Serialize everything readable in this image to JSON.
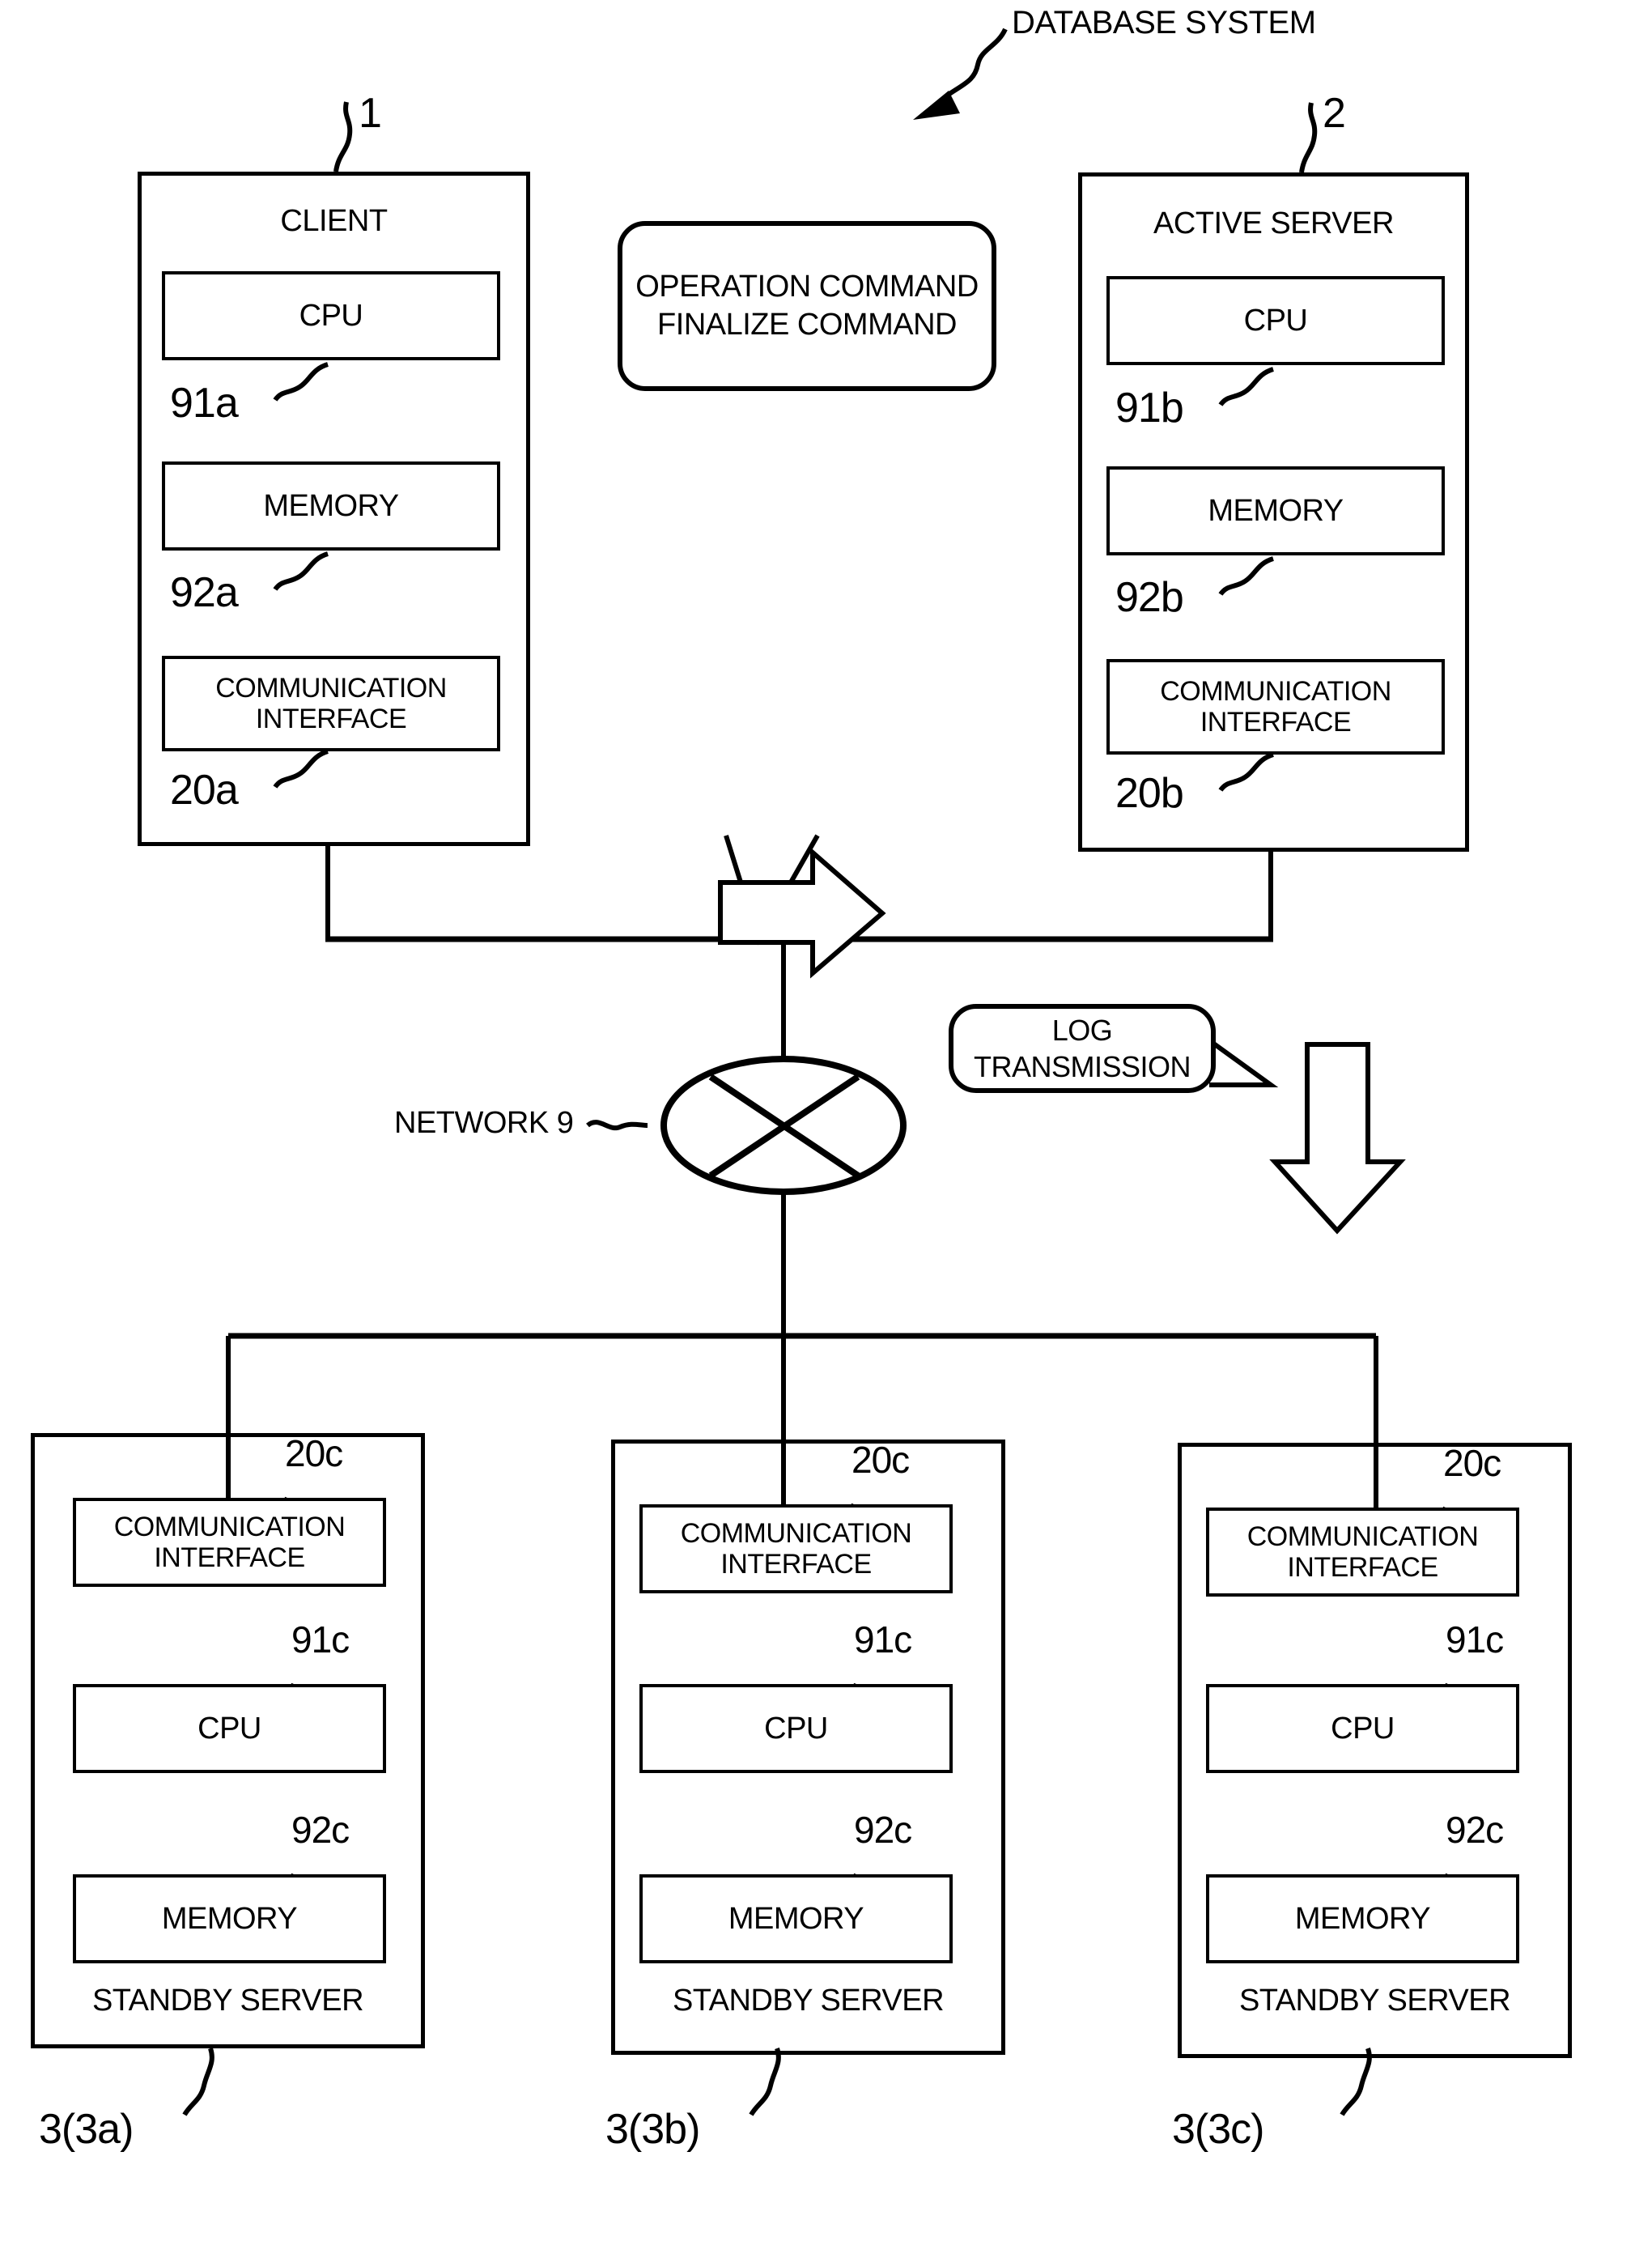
{
  "figure": {
    "title": "DATABASE SYSTEM",
    "network_label": "NETWORK 9",
    "network_ref": "9"
  },
  "callouts": {
    "command_bubble": {
      "line1": "OPERATION COMMAND",
      "line2": "FINALIZE COMMAND"
    },
    "log_bubble": {
      "line1": "LOG",
      "line2": "TRANSMISSION"
    }
  },
  "client": {
    "title": "CLIENT",
    "ref": "1",
    "units": [
      {
        "label": "CPU",
        "ref": "91a"
      },
      {
        "label": "MEMORY",
        "ref": "92a"
      },
      {
        "label_line1": "COMMUNICATION",
        "label_line2": "INTERFACE",
        "ref": "20a"
      }
    ]
  },
  "active_server": {
    "title": "ACTIVE SERVER",
    "ref": "2",
    "units": [
      {
        "label": "CPU",
        "ref": "91b"
      },
      {
        "label": "MEMORY",
        "ref": "92b"
      },
      {
        "label_line1": "COMMUNICATION",
        "label_line2": "INTERFACE",
        "ref": "20b"
      }
    ]
  },
  "standby_servers": [
    {
      "title": "STANDBY SERVER",
      "ref": "3(3a)",
      "units": [
        {
          "label_line1": "COMMUNICATION",
          "label_line2": "INTERFACE",
          "ref": "20c"
        },
        {
          "label": "CPU",
          "ref": "91c"
        },
        {
          "label": "MEMORY",
          "ref": "92c"
        }
      ]
    },
    {
      "title": "STANDBY SERVER",
      "ref": "3(3b)",
      "units": [
        {
          "label_line1": "COMMUNICATION",
          "label_line2": "INTERFACE",
          "ref": "20c"
        },
        {
          "label": "CPU",
          "ref": "91c"
        },
        {
          "label": "MEMORY",
          "ref": "92c"
        }
      ]
    },
    {
      "title": "STANDBY SERVER",
      "ref": "3(3c)",
      "units": [
        {
          "label_line1": "COMMUNICATION",
          "label_line2": "INTERFACE",
          "ref": "20c"
        },
        {
          "label": "CPU",
          "ref": "91c"
        },
        {
          "label": "MEMORY",
          "ref": "92c"
        }
      ]
    }
  ],
  "colors": {
    "line": "#000000",
    "background": "#ffffff"
  }
}
